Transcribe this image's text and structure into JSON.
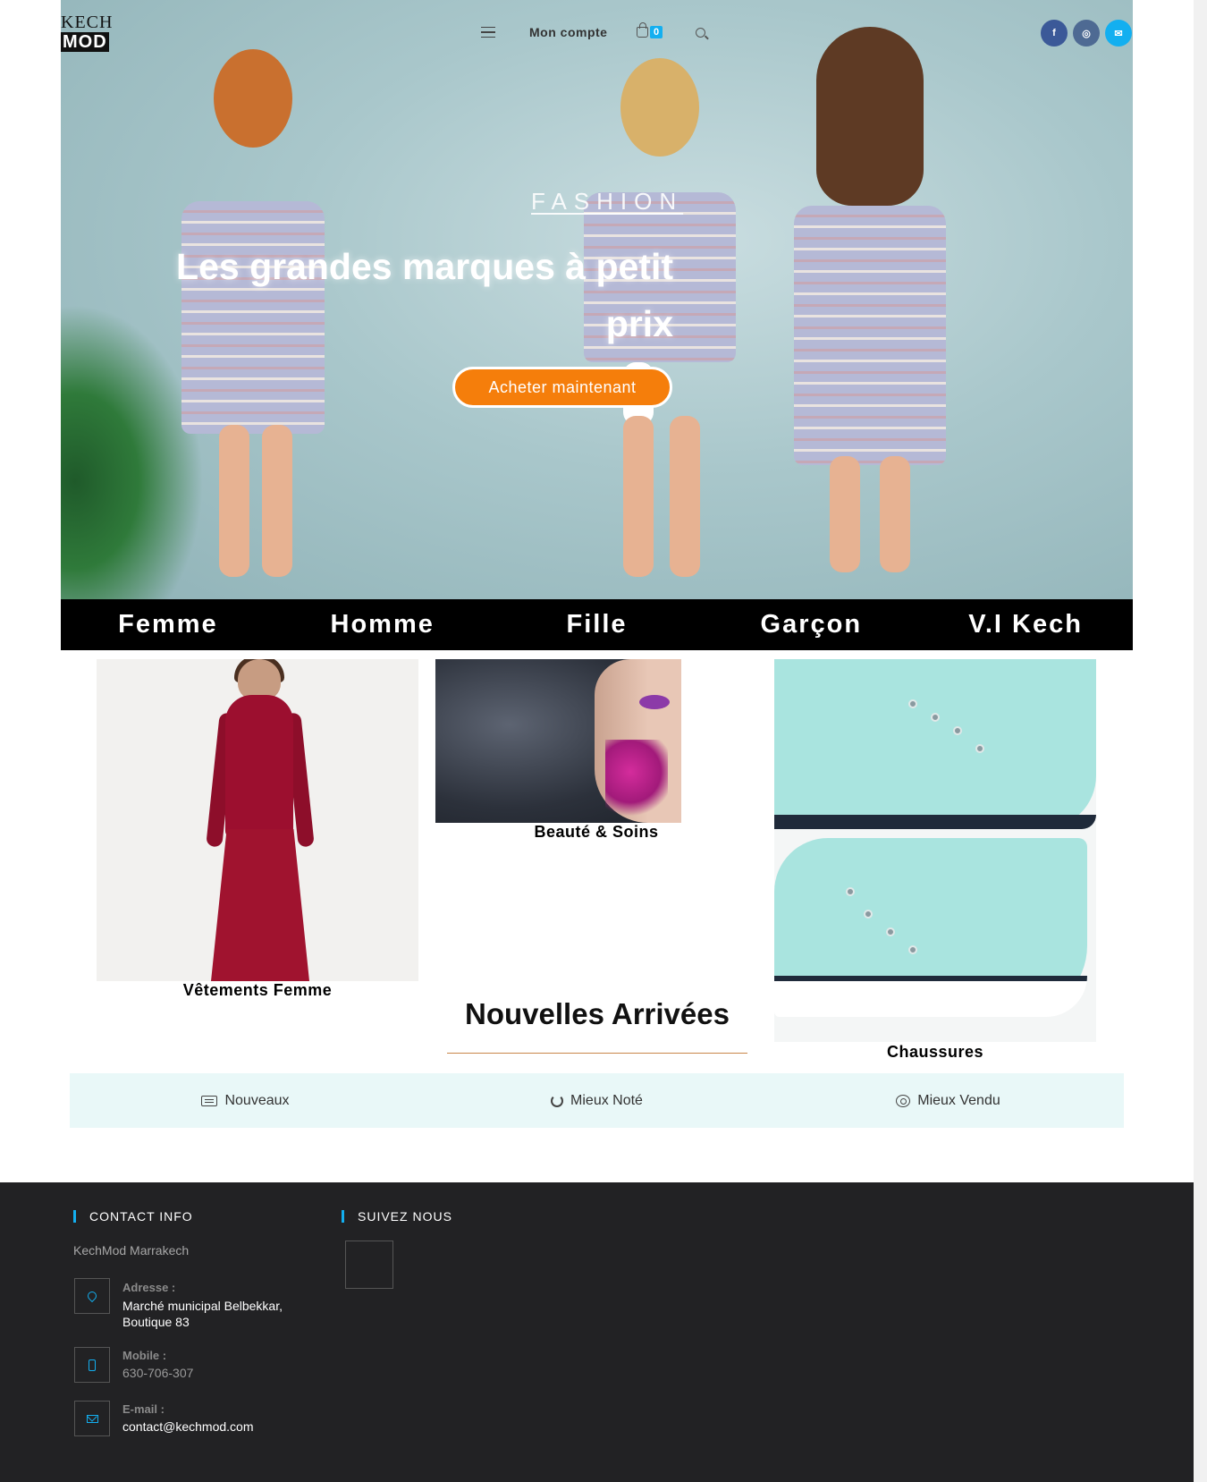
{
  "brand": {
    "logo_line1": "KECH",
    "logo_line2": "MOD"
  },
  "header": {
    "account_label": "Mon compte",
    "cart_count": "0",
    "social": [
      {
        "icon": "facebook-icon",
        "glyph": "f"
      },
      {
        "icon": "instagram-icon",
        "glyph": "◎"
      },
      {
        "icon": "email-icon",
        "glyph": "✉"
      }
    ]
  },
  "hero": {
    "eyebrow": "FASHION",
    "headline": "Les grandes marques à petit prix",
    "cta_label": "Acheter maintenant"
  },
  "categories": [
    "Femme",
    "Homme",
    "Fille",
    "Garçon",
    "V.I Kech"
  ],
  "tiles": {
    "femme": "Vêtements Femme",
    "beaute": "Beauté & Soins",
    "chaussures": "Chaussures"
  },
  "new_arrivals": {
    "title": "Nouvelles Arrivées",
    "tabs": [
      "Nouveaux",
      "Mieux Noté",
      "Mieux Vendu"
    ]
  },
  "footer": {
    "contact_heading": "CONTACT INFO",
    "follow_heading": "SUIVEZ NOUS",
    "company": "KechMod Marrakech",
    "address_label": "Adresse :",
    "address_value": "Marché municipal Belbekkar, Boutique 83",
    "mobile_label": "Mobile :",
    "mobile_value": "630-706-307",
    "email_label": "E-mail :",
    "email_value": "contact@kechmod.com"
  },
  "colors": {
    "accent_orange": "#f57e0b",
    "accent_blue": "#13aff0",
    "footer_bg": "#222224",
    "tabs_bg": "#e9f8f8"
  }
}
